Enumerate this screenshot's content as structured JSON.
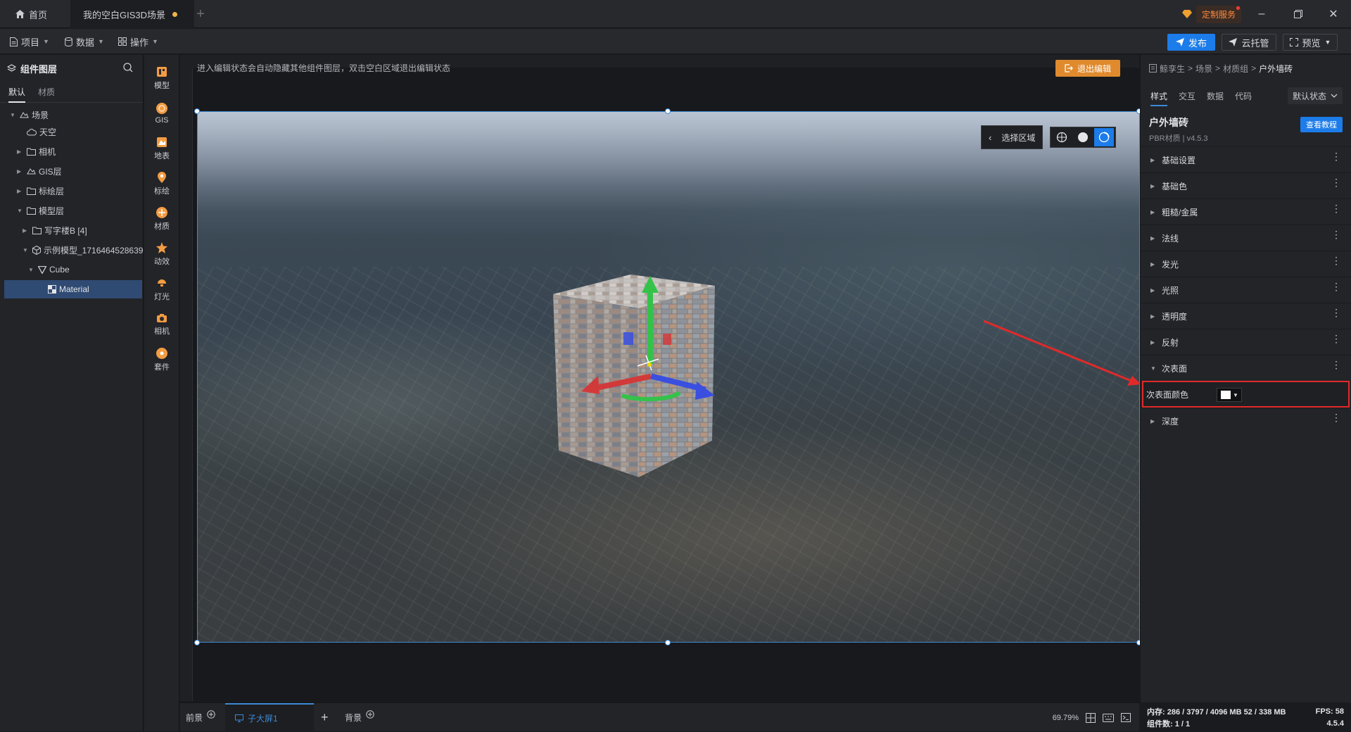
{
  "titlebar": {
    "tabs": [
      {
        "label": "首页"
      },
      {
        "label": "我的空白GIS3D场景"
      }
    ],
    "custom_service": "定制服务"
  },
  "toolbar": {
    "menus": [
      {
        "label": "项目"
      },
      {
        "label": "数据"
      },
      {
        "label": "操作"
      }
    ],
    "publish": "发布",
    "cloud": "云托管",
    "preview": "预览"
  },
  "left_panel": {
    "title": "组件图层",
    "tabs": [
      "默认",
      "材质"
    ],
    "tree": [
      {
        "label": "场景"
      },
      {
        "label": "天空"
      },
      {
        "label": "相机"
      },
      {
        "label": "GIS层"
      },
      {
        "label": "标绘层"
      },
      {
        "label": "模型层"
      },
      {
        "label": "写字楼B [4]"
      },
      {
        "label": "示例模型_1716464528639"
      },
      {
        "label": "Cube"
      },
      {
        "label": "Material"
      }
    ]
  },
  "icon_bar": [
    {
      "label": "模型",
      "icon": "model-icon"
    },
    {
      "label": "GIS",
      "icon": "gis-icon"
    },
    {
      "label": "地表",
      "icon": "terrain-icon"
    },
    {
      "label": "标绘",
      "icon": "pin-icon"
    },
    {
      "label": "材质",
      "icon": "material-icon"
    },
    {
      "label": "动效",
      "icon": "effect-icon"
    },
    {
      "label": "灯光",
      "icon": "light-icon"
    },
    {
      "label": "相机",
      "icon": "camera-icon"
    },
    {
      "label": "套件",
      "icon": "kit-icon"
    }
  ],
  "canvas": {
    "notice": "进入编辑状态会自动隐藏其他组件图层，双击空白区域退出编辑状态",
    "exit_edit": "退出编辑",
    "select_area": "选择区域"
  },
  "bottom_bar": {
    "foreground": "前景",
    "sub_screen": "子大屏1",
    "background": "背景",
    "zoom": "69.79%"
  },
  "right_panel": {
    "breadcrumb": [
      "鲸孪生",
      "场景",
      "材质组",
      "户外墙砖"
    ],
    "tabs": [
      "样式",
      "交互",
      "数据",
      "代码"
    ],
    "state": "默认状态",
    "material_title": "户外墙砖",
    "material_sub": "PBR材质 | v4.5.3",
    "tutorial": "查看教程",
    "sections": [
      {
        "label": "基础设置",
        "open": false
      },
      {
        "label": "基础色",
        "open": false
      },
      {
        "label": "粗糙/金属",
        "open": false
      },
      {
        "label": "法线",
        "open": false
      },
      {
        "label": "发光",
        "open": false
      },
      {
        "label": "光照",
        "open": false
      },
      {
        "label": "透明度",
        "open": false
      },
      {
        "label": "反射",
        "open": false
      },
      {
        "label": "次表面",
        "open": true
      },
      {
        "label": "深度",
        "open": false
      }
    ],
    "subsurface_color_label": "次表面颜色",
    "subsurface_color": "#ffffff"
  },
  "status": {
    "memory": "内存: 286 / 3797 / 4096 MB  52 / 338 MB",
    "fps": "FPS: 58",
    "components": "组件数: 1 / 1",
    "version": "4.5.4"
  },
  "colors": {
    "accent": "#1c7ce9",
    "highlight": "#e02a2a",
    "orange": "#e08a2e"
  }
}
